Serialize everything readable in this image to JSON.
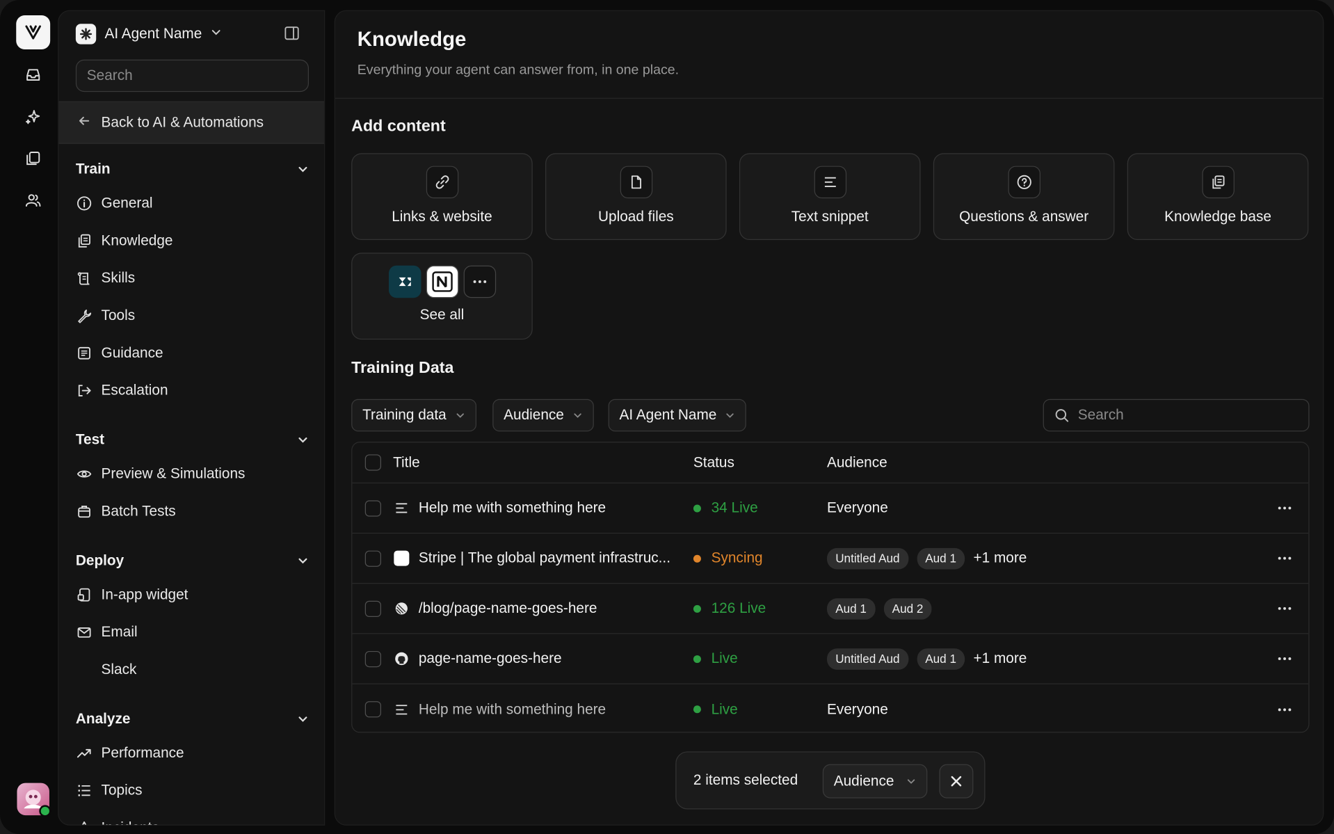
{
  "sidebar": {
    "agent_name": "AI Agent Name",
    "search_placeholder": "Search",
    "back_label": "Back to AI & Automations",
    "sections": {
      "train": {
        "title": "Train",
        "items": [
          "General",
          "Knowledge",
          "Skills",
          "Tools",
          "Guidance",
          "Escalation"
        ]
      },
      "test": {
        "title": "Test",
        "items": [
          "Preview & Simulations",
          "Batch Tests"
        ]
      },
      "deploy": {
        "title": "Deploy",
        "items": [
          "In-app widget",
          "Email",
          "Slack"
        ]
      },
      "analyze": {
        "title": "Analyze",
        "items": [
          "Performance",
          "Topics",
          "Incidents"
        ]
      }
    }
  },
  "header": {
    "title": "Knowledge",
    "subtitle": "Everything your agent can answer from, in one place."
  },
  "add_content": {
    "title": "Add content",
    "cards": [
      {
        "label": "Links & website",
        "icon": "link-icon"
      },
      {
        "label": "Upload files",
        "icon": "file-icon"
      },
      {
        "label": "Text snippet",
        "icon": "text-lines-icon"
      },
      {
        "label": "Questions & answer",
        "icon": "question-circle-icon"
      },
      {
        "label": "Knowledge base",
        "icon": "copy-stack-icon"
      }
    ],
    "integrations_label": "See all"
  },
  "training": {
    "title": "Training Data",
    "filters": [
      "Training data",
      "Audience",
      "AI Agent Name"
    ],
    "search_placeholder": "Search",
    "columns": {
      "title": "Title",
      "status": "Status",
      "audience": "Audience"
    },
    "rows": [
      {
        "title": "Help me with something here",
        "icon": "text-lines-icon",
        "status": "34 Live",
        "status_color": "#2ea043",
        "audience_text": "Everyone",
        "chips": [],
        "more": ""
      },
      {
        "title": "Stripe | The global payment infrastruc...",
        "icon": "stripe-favicon-icon",
        "status": "Syncing",
        "status_color": "#e0852b",
        "audience_text": "",
        "chips": [
          "Untitled Aud",
          "Aud 1"
        ],
        "more": "+1 more"
      },
      {
        "title": "/blog/page-name-goes-here",
        "icon": "linear-favicon-icon",
        "status": "126 Live",
        "status_color": "#2ea043",
        "audience_text": "",
        "chips": [
          "Aud 1",
          "Aud 2"
        ],
        "more": ""
      },
      {
        "title": "page-name-goes-here",
        "icon": "github-icon",
        "status": "Live",
        "status_color": "#2ea043",
        "audience_text": "",
        "chips": [
          "Untitled Aud",
          "Aud 1"
        ],
        "more": "+1 more"
      },
      {
        "title": "Help me with something here",
        "icon": "text-lines-icon",
        "status": "Live",
        "status_color": "#2ea043",
        "audience_text": "Everyone",
        "chips": [],
        "more": ""
      }
    ]
  },
  "selection_bar": {
    "text": "2 items selected",
    "audience_label": "Audience"
  }
}
